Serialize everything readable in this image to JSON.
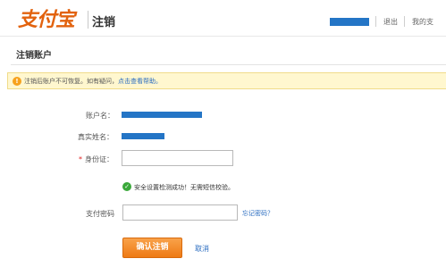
{
  "header": {
    "logo_text": "支付宝",
    "section_title": "注销",
    "top_links": [
      "退出",
      "我的支"
    ]
  },
  "page": {
    "title": "注销账户"
  },
  "notice": {
    "icon": "warning-icon",
    "text": "注销后账户不可恢复。如有疑问，",
    "link_text": "点击查看帮助。"
  },
  "form": {
    "account_label": "账户名：",
    "realname_label": "真实姓名：",
    "id_required_mark": "*",
    "id_label": "身份证：",
    "id_value": "",
    "security_check_text": "安全设置检测成功！无需短信校验。",
    "pay_password_label": "支付密码",
    "pay_password_value": "",
    "forgot_password_link": "忘记密码？",
    "confirm_button": "确认注销",
    "cancel_link": "取消"
  },
  "colors": {
    "brand_orange": "#e2620e",
    "redaction_blue": "#2475c6",
    "link_blue": "#2a6cc0",
    "notice_bg": "#fff7cf",
    "success_green": "#3aa83a"
  }
}
